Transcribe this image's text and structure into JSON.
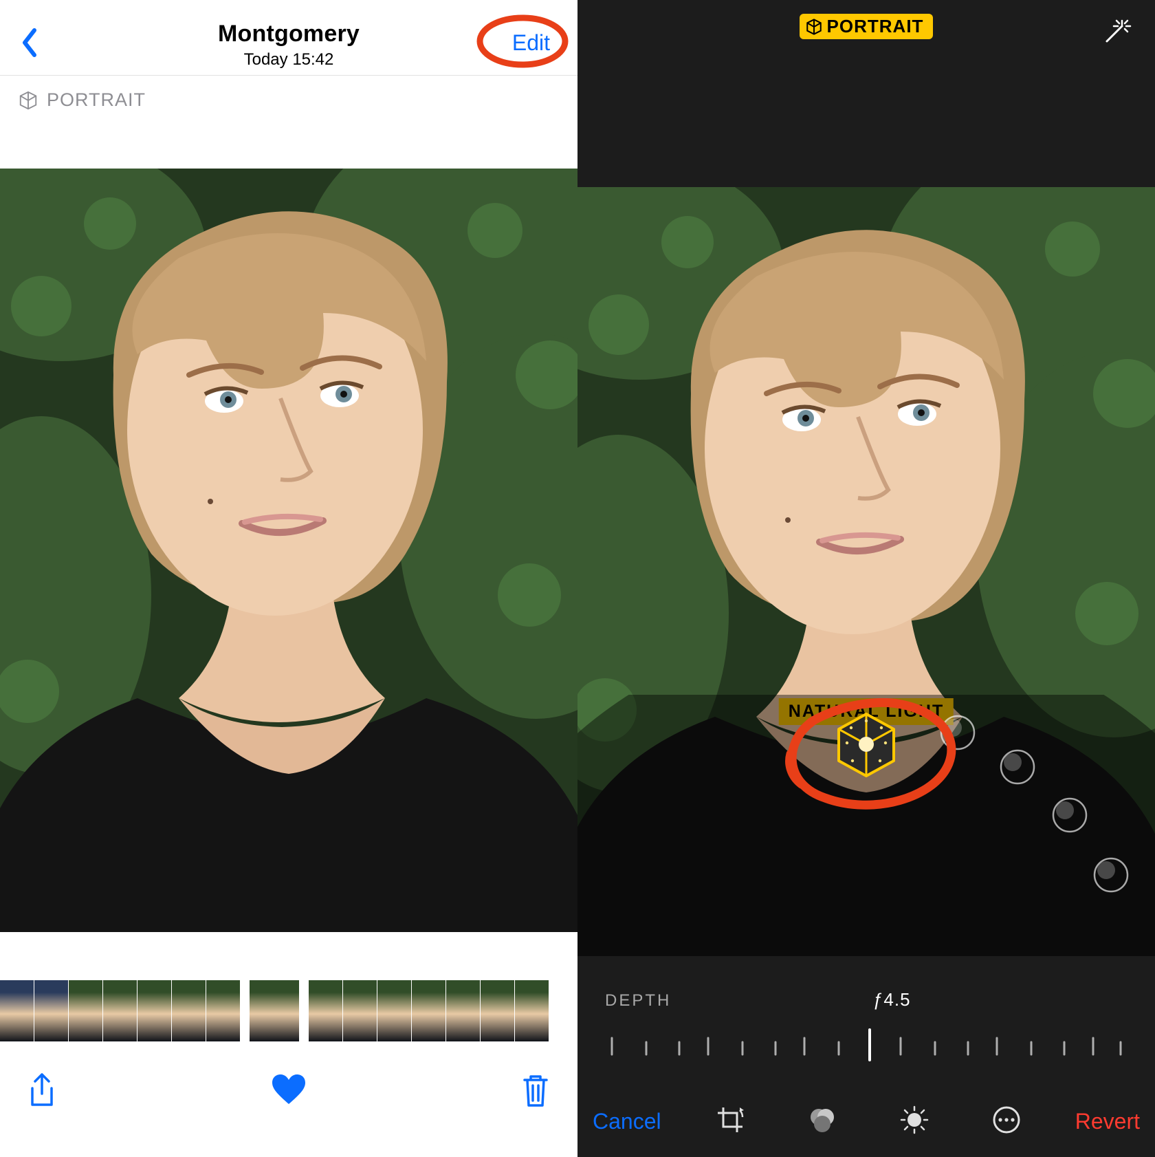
{
  "left": {
    "title": "Montgomery",
    "subtitle": "Today  15:42",
    "edit_label": "Edit",
    "mode_badge": "PORTRAIT"
  },
  "right": {
    "portrait_pill": "PORTRAIT",
    "lighting_label": "NATURAL LIGHT",
    "depth_label": "DEPTH",
    "depth_value": "ƒ4.5",
    "cancel_label": "Cancel",
    "revert_label": "Revert"
  },
  "colors": {
    "ios_blue": "#0b6dff",
    "ios_red": "#ff3b30",
    "yellow": "#ffc800",
    "annotation_red": "#e83f18"
  }
}
